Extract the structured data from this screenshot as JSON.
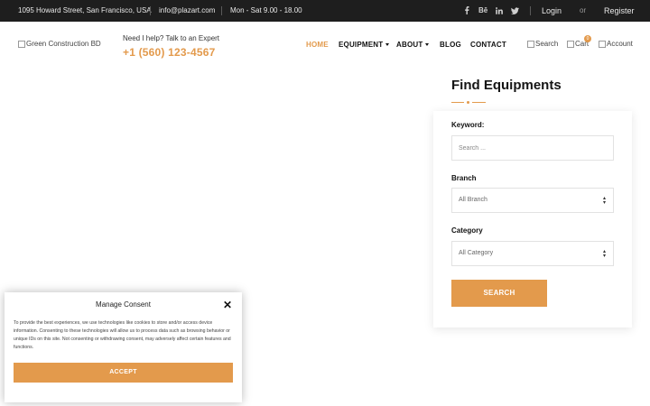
{
  "topbar": {
    "address": "1095 Howard Street, San Francisco, USA",
    "email": "info@plazart.com",
    "hours": "Mon - Sat 9.00 - 18.00",
    "social": [
      "facebook-icon",
      "behance-icon",
      "linkedin-icon",
      "twitter-icon"
    ],
    "behance_label": "Bē",
    "login": "Login",
    "or": "or",
    "register": "Register"
  },
  "header": {
    "logo_alt": "Green Construction BD",
    "help_text": "Need I help? Talk to an Expert",
    "phone": "+1 (560) 123-4567",
    "nav": [
      {
        "label": "HOME"
      },
      {
        "label": "EQUIPMENT"
      },
      {
        "label": "ABOUT"
      },
      {
        "label": "BLOG"
      },
      {
        "label": "CONTACT"
      }
    ],
    "search_alt": "Search",
    "cart_alt": "Cart",
    "cart_count": "0",
    "account_alt": "Account"
  },
  "widget": {
    "title": "Find Equipments",
    "keyword_label": "Keyword:",
    "keyword_placeholder": "Search ...",
    "branch_label": "Branch",
    "branch_value": "All Branch",
    "category_label": "Category",
    "category_value": "All Category",
    "search_button": "SEARCH"
  },
  "consent": {
    "title": "Manage Consent",
    "text": "To provide the best experiences, we use technologies like cookies to store and/or access device information. Consenting to these technologies will allow us to process data such as browsing behavior or unique IDs on this site. Not consenting or withdrawing consent, may adversely affect certain features and functions.",
    "accept": "ACCEPT"
  },
  "colors": {
    "accent": "#e39a4c",
    "topbar": "#1e1e1e"
  }
}
